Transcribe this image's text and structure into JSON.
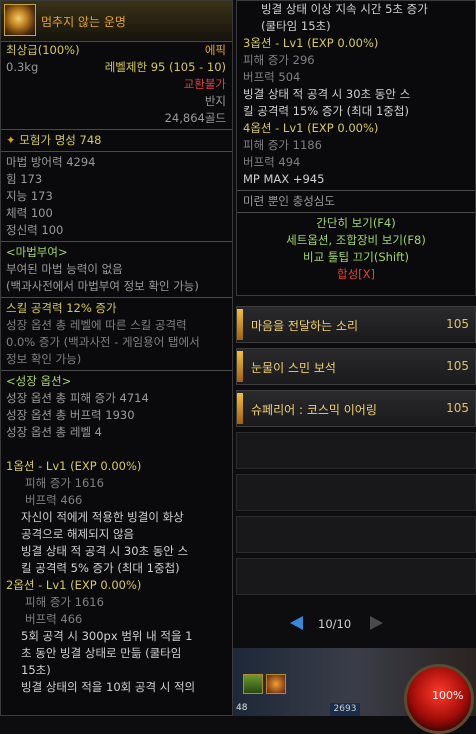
{
  "left": {
    "item_name": "멈추지 않는 운명",
    "grade": "최상급(100%)",
    "rarity": "에픽",
    "weight": "0.3kg",
    "level_limit": "레벨제한 95 (105 - 10)",
    "untradable": "교환불가",
    "slot": "반지",
    "price": "24,864골드",
    "fame": "모험가 명성 748",
    "stats": [
      "마법 방어력 4294",
      "힘 173",
      "지능 173",
      "체력 100",
      "정신력 100"
    ],
    "enchant_header": "<마법부여>",
    "enchant_lines": [
      "부여된 마법 능력이 없음",
      "(백과사전에서 마법부여 정보 확인 가능)"
    ],
    "skill_header": "스킬 공격력 12% 증가",
    "skill_lines": [
      "성장 옵션 총 레벨에 따른 스킬 공격력",
      "0.0% 증가 (백과사전 - 게임용어 탭에서",
      "정보 확인 가능)"
    ],
    "growth_header": "<성장 옵션>",
    "growth_lines": [
      "성장 옵션 총 피해 증가 4714",
      "성장 옵션 총 버프력 1930",
      "성장 옵션 총 레벨 4"
    ],
    "opt1_header": "1옵션 - Lv1 (EXP 0.00%)",
    "opt1_dmg": "피해 증가 1616",
    "opt1_buff": "버프력 466",
    "opt1_lines": [
      "자신이 적에게 적용한 빙결이 화상",
      "공격으로 해제되지 않음",
      "빙결 상태 적 공격 시 30초 동안 스",
      "킬 공격력 5% 증가 (최대 1중첩)"
    ],
    "opt2_header": "2옵션 - Lv1 (EXP 0.00%)",
    "opt2_dmg": "피해 증가 1616",
    "opt2_buff": "버프력 466",
    "opt2_lines": [
      "5회 공격 시 300px 범위 내 적을 1",
      "초 동안 빙결 상태로 만듦 (쿨타임",
      "15초)",
      "빙결 상태의 적을 10회 공격 시 적의"
    ]
  },
  "right": {
    "top_lines": [
      "빙결 상태 이상 지속 시간 5초 증가",
      "(쿨타임 15초)"
    ],
    "opt3_header": "3옵션 - Lv1 (EXP 0.00%)",
    "opt3_dmg": "피해 증가 296",
    "opt3_buff": "버프력 504",
    "opt3_lines": [
      "빙결 상태 적 공격 시 30초 동안 스",
      "킬 공격력 15% 증가 (최대 1중첩)"
    ],
    "opt4_header": "4옵션 - Lv1 (EXP 0.00%)",
    "opt4_dmg": "피해 증가 1186",
    "opt4_buff": "버프력 494",
    "opt4_mp": "MP MAX +945",
    "flavor": "미련 뿐인 충성심도",
    "btn_simple": "간단히 보기(F4)",
    "btn_set": "세트옵션, 조합장비 보기(F8)",
    "btn_compare": "비교 툴팁 끄기(Shift)",
    "btn_craft": "합성[X]"
  },
  "list": [
    {
      "name": "마음을 전달하는 소리",
      "count": "105"
    },
    {
      "name": "눈물이 스민 보석",
      "count": "105"
    },
    {
      "name": "슈페리어 : 코스믹 이어링",
      "count": "105"
    }
  ],
  "pager": {
    "label": "10/10"
  },
  "hud": {
    "hp": "100%",
    "counter": "2693",
    "slot_num": "48"
  },
  "colors": {
    "epic": "#e5a526",
    "growth": "#a3d66a",
    "option": "#d6c85c",
    "untradable": "#e04040"
  }
}
